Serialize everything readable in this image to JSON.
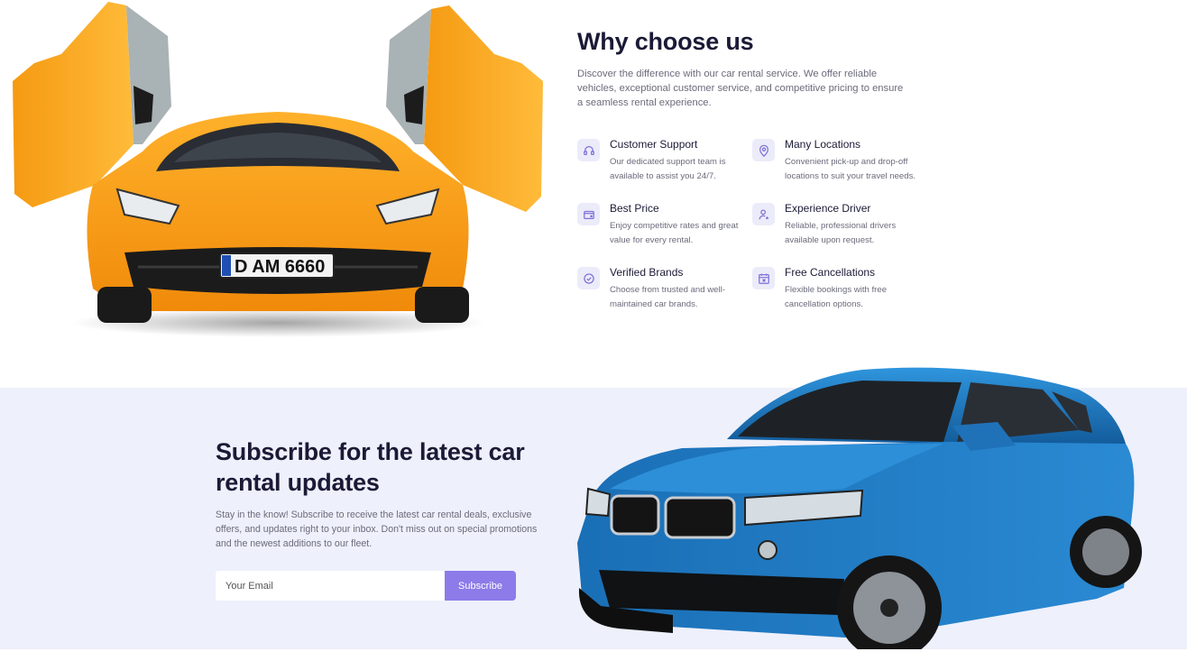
{
  "why_choose": {
    "title": "Why choose us",
    "intro": "Discover the difference with our car rental service. We offer reliable vehicles, exceptional customer service, and competitive pricing to ensure a seamless rental experience.",
    "features": [
      {
        "icon": "headset-icon",
        "title": "Customer Support",
        "desc": "Our dedicated support team is available to assist you 24/7."
      },
      {
        "icon": "location-pin-icon",
        "title": "Many Locations",
        "desc": "Convenient pick-up and drop-off locations to suit your travel needs."
      },
      {
        "icon": "wallet-icon",
        "title": "Best Price",
        "desc": "Enjoy competitive rates and great value for every rental."
      },
      {
        "icon": "driver-star-icon",
        "title": "Experience Driver",
        "desc": "Reliable, professional drivers available upon request."
      },
      {
        "icon": "verified-badge-icon",
        "title": "Verified Brands",
        "desc": "Choose from trusted and well-maintained car brands."
      },
      {
        "icon": "calendar-cancel-icon",
        "title": "Free Cancellations",
        "desc": "Flexible bookings with free cancellation options."
      }
    ]
  },
  "orange_car": {
    "plate": "D AM 6660"
  },
  "subscribe": {
    "title": "Subscribe for the latest car rental updates",
    "desc": "Stay in the know! Subscribe to receive the latest car rental deals, exclusive offers, and updates right to your inbox. Don't miss out on special promotions and the newest additions to our fleet.",
    "email_placeholder": "Your Email",
    "button_label": "Subscribe"
  },
  "colors": {
    "accent": "#8c7be9",
    "icon_bg": "#ecebfa",
    "section_bg": "#eef0fb",
    "orange_car": "#f7a21b",
    "blue_car": "#1f7cc4"
  }
}
